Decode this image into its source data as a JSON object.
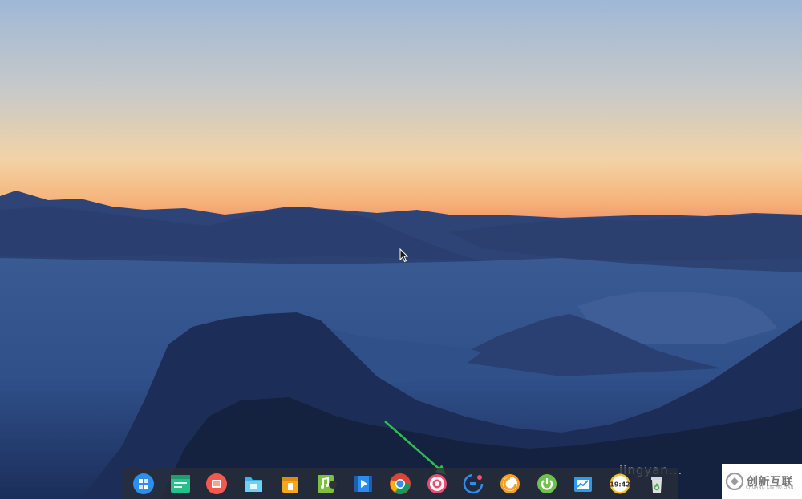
{
  "desktop": {
    "wallpaper_name": "mountain-sunset-fog",
    "watermark_text": "jingyan..."
  },
  "dock": {
    "items": [
      {
        "name": "launcher",
        "icon": "launcher-icon",
        "color": "#2f8ee9"
      },
      {
        "name": "terminal",
        "icon": "terminal-icon",
        "color": "#27c08a"
      },
      {
        "name": "presentation",
        "icon": "presentation-icon",
        "color": "#f35a4d"
      },
      {
        "name": "file-manager",
        "icon": "folder-icon",
        "color": "#3bb5e6"
      },
      {
        "name": "app-store",
        "icon": "store-icon",
        "color": "#f5a623"
      },
      {
        "name": "music",
        "icon": "music-icon",
        "color": "#7bc043"
      },
      {
        "name": "video",
        "icon": "video-icon",
        "color": "#2b8df1"
      },
      {
        "name": "chrome",
        "icon": "chrome-icon",
        "color": "#4285f4"
      },
      {
        "name": "settings",
        "icon": "gear-icon",
        "color": "#e94d6f"
      },
      {
        "name": "screenshot",
        "icon": "screenshot-icon",
        "color": "#2a8ff0"
      },
      {
        "name": "browser",
        "icon": "browser-icon",
        "color": "#f29f24"
      },
      {
        "name": "shutdown",
        "icon": "power-icon",
        "color": "#6cc24a"
      },
      {
        "name": "system-monitor",
        "icon": "monitor-icon",
        "color": "#2a9bf0"
      },
      {
        "name": "clock",
        "icon": "clock-icon",
        "color": "#f4c430",
        "time_text": "19:42"
      },
      {
        "name": "trash",
        "icon": "trash-icon",
        "color": "#e0e0e0"
      }
    ]
  },
  "logo": {
    "text": "创新互联",
    "subtext": "CHUANG XIN HU LIAN"
  }
}
